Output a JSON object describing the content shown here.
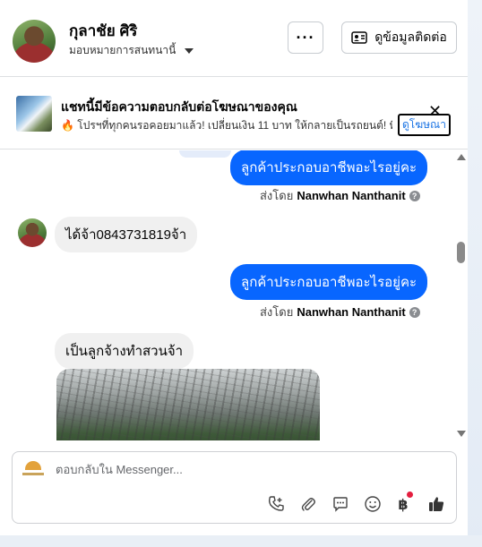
{
  "header": {
    "name": "กุลาชัย ศิริ",
    "assign_label": "มอบหมายการสนทนานี้",
    "more_label": "···",
    "contact_label": "ดูข้อมูลติดต่อ"
  },
  "ad_banner": {
    "title": "แชทนี้มีข้อความตอบกลับต่อโฆษณาของคุณ",
    "description": "🔥 โปรฯที่ทุกคนรอคอยมาแล้ว! เปลี่ยนเงิน 11 บาท ให้กลายเป็นรถยนต์! ที่ โ...",
    "view_ad_label": "ดูโฆษณา",
    "close_label": "✕"
  },
  "messages": [
    {
      "direction": "out",
      "text": "ลูกค้าประกอบอาชีพอะไรอยู่คะ",
      "sent_by_prefix": "ส่งโดย",
      "sent_by_name": "Nanwhan Nanthanit"
    },
    {
      "direction": "in",
      "text": "ได้จ้า0843731819จ้า"
    },
    {
      "direction": "out",
      "text": "ลูกค้าประกอบอาชีพอะไรอยู่คะ",
      "sent_by_prefix": "ส่งโดย",
      "sent_by_name": "Nanwhan Nanthanit"
    },
    {
      "direction": "in",
      "text": "เป็นลูกจ้างทำสวนจ้า"
    }
  ],
  "composer": {
    "placeholder": "ตอบกลับใน Messenger...",
    "tools": [
      "phone-plus-icon",
      "paperclip-icon",
      "chat-bubble-icon",
      "emoji-icon",
      "baht-icon",
      "thumbs-up-icon"
    ],
    "baht_symbol": "฿"
  },
  "colors": {
    "outgoing_bubble": "#0866ff",
    "incoming_bubble": "#f0f0f0",
    "link": "#1b74e4",
    "notification_dot": "#e41e3f"
  }
}
